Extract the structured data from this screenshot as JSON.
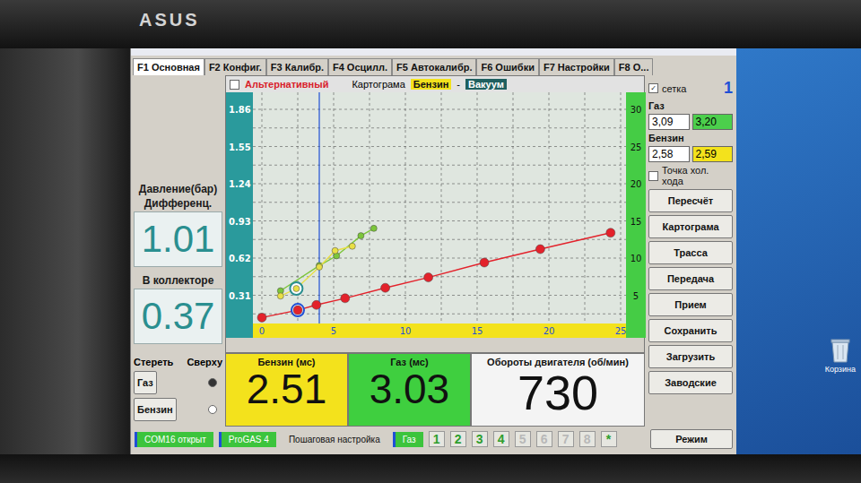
{
  "bezel": {
    "logo": "ASUS"
  },
  "tabs": [
    {
      "label": "F1 Основная",
      "selected": true
    },
    {
      "label": "F2 Конфиг.",
      "selected": false
    },
    {
      "label": "F3 Калибр.",
      "selected": false
    },
    {
      "label": "F4 Осцилл.",
      "selected": false
    },
    {
      "label": "F5 Автокалибр.",
      "selected": false
    },
    {
      "label": "F6 Ошибки",
      "selected": false
    },
    {
      "label": "F7 Настройки",
      "selected": false
    },
    {
      "label": "F8 О...",
      "selected": false
    }
  ],
  "pressure": {
    "label": "Давление(бар)",
    "sublabel": "Дифференц.",
    "value": "1.01"
  },
  "manifold": {
    "label": "В коллекторе",
    "value": "0.37"
  },
  "chart": {
    "alternative": {
      "label": "Альтернативный",
      "checked": false
    },
    "title": "Картограма",
    "fuel": "Бензин",
    "separator": "-",
    "mode": "Вакуум",
    "y_left_ticks": [
      "1.86",
      "1.55",
      "1.24",
      "0.93",
      "0.62",
      "0.31"
    ],
    "y_right_ticks": [
      "30",
      "25",
      "20",
      "15",
      "10",
      "5"
    ],
    "x_ticks": [
      "0",
      "5",
      "10",
      "15",
      "20",
      "25"
    ],
    "cursor_x": 4,
    "series": [
      {
        "color": "#e3222b",
        "x": [
          0,
          2.5,
          3.8,
          5.8,
          8.6,
          11.6,
          15.5,
          19.4,
          24.3
        ],
        "y": [
          2,
          3,
          3.7,
          4.6,
          6,
          7.4,
          9.4,
          11.2,
          13.4
        ],
        "marked_index": 1,
        "marked_ring": "#1f4fd6"
      },
      {
        "color": "#7cc63a",
        "x": [
          1.3,
          4,
          5.2,
          6.9,
          7.8
        ],
        "y": [
          5.6,
          9,
          10.3,
          13,
          14
        ],
        "marked_index": -1,
        "marked_ring": "#2a8f90"
      },
      {
        "color": "#e8df45",
        "x": [
          1.3,
          2.4,
          4,
          5.1,
          6.3
        ],
        "y": [
          4.9,
          5.9,
          8.8,
          11,
          11.6
        ],
        "marked_index": 1,
        "marked_ring": "#2a8f90"
      }
    ]
  },
  "grid_checkbox": {
    "label": "сетка",
    "checked": true
  },
  "page_number": "1",
  "gas": {
    "label": "Газ",
    "fields": [
      {
        "value": "3,09",
        "color": "#ffffff"
      },
      {
        "value": "3,20",
        "color": "#4ccf4c"
      }
    ]
  },
  "petrol": {
    "label": "Бензин",
    "fields": [
      {
        "value": "2,58",
        "color": "#ffffff"
      },
      {
        "value": "2,59",
        "color": "#f3e21c"
      }
    ]
  },
  "idle_checkbox": {
    "label": "Точка хол. хода",
    "checked": false
  },
  "buttons": [
    "Пересчёт",
    "Картограма",
    "Трасса",
    "Передача",
    "Прием",
    "Сохранить",
    "Загрузить",
    "Заводские"
  ],
  "erase": {
    "label": "Стереть",
    "top_label": "Сверху",
    "options": [
      {
        "label": "Газ",
        "selected": true
      },
      {
        "label": "Бензин",
        "selected": false
      }
    ]
  },
  "readouts": [
    {
      "label": "Бензин (мс)",
      "value": "2.51",
      "color": "#f3e21c"
    },
    {
      "label": "Газ (мс)",
      "value": "3.03",
      "color": "#3fcf3f"
    },
    {
      "label": "Обороты двигателя (об/мин)",
      "value": "730",
      "color": "#f4f4f4"
    }
  ],
  "status": {
    "items": [
      {
        "text": "COM16 открыт",
        "highlight": true
      },
      {
        "text": "ProGAS 4",
        "highlight": true
      },
      {
        "text": "Пошаговая настройка",
        "highlight": false
      },
      {
        "text": "Газ",
        "highlight": true
      }
    ],
    "steps": [
      {
        "label": "1",
        "enabled": true
      },
      {
        "label": "2",
        "enabled": true
      },
      {
        "label": "3",
        "enabled": true
      },
      {
        "label": "4",
        "enabled": true
      },
      {
        "label": "5",
        "enabled": false
      },
      {
        "label": "6",
        "enabled": false
      },
      {
        "label": "7",
        "enabled": false
      },
      {
        "label": "8",
        "enabled": false
      }
    ],
    "star": "*",
    "mode_button": "Режим"
  },
  "desktop": {
    "recycle_bin": "Корзина"
  }
}
